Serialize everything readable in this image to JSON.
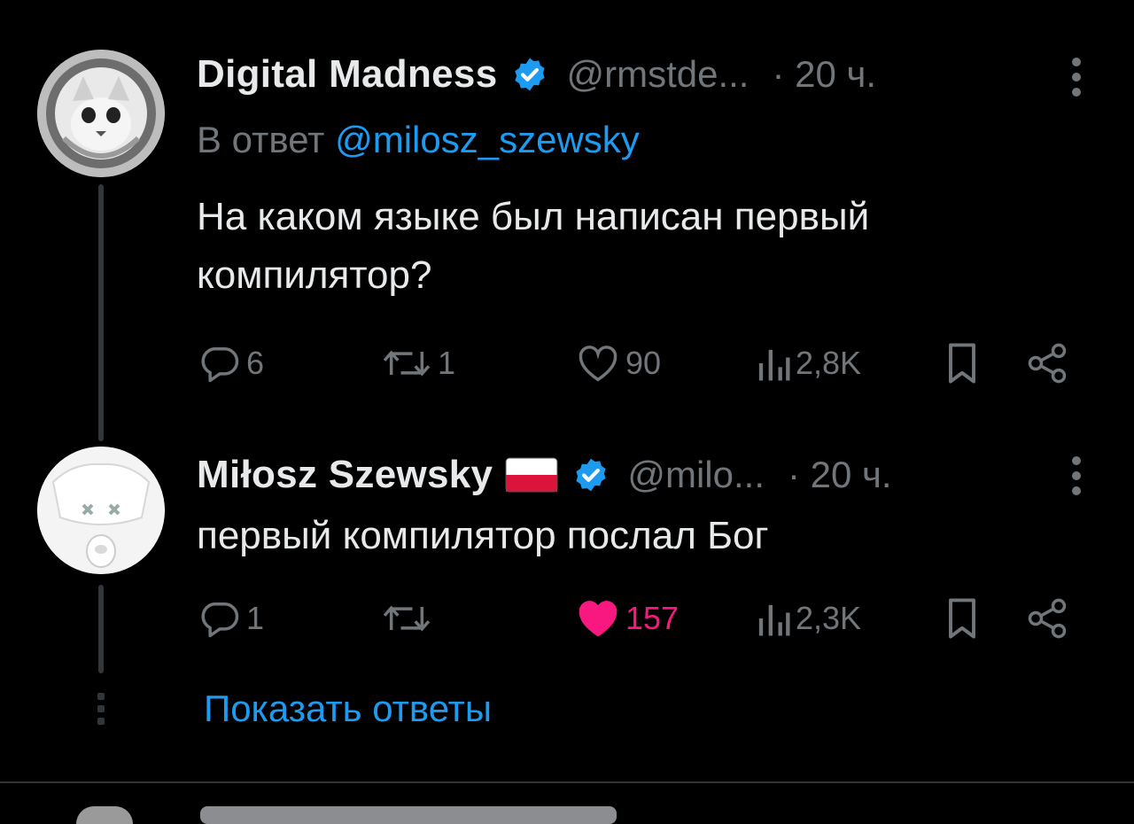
{
  "tweets": [
    {
      "author_name": "Digital Madness",
      "verified": true,
      "handle": "@rmstde...",
      "time": "· 20 ч.",
      "reply_prefix": "В ответ",
      "reply_mention": "@milosz_szewsky",
      "text": "На каком языке был написан первый компилятор?",
      "replies": "6",
      "retweets": "1",
      "likes": "90",
      "liked": false,
      "views": "2,8K",
      "avatar_icon": "cat-astronaut-avatar-icon"
    },
    {
      "author_name": "Miłosz Szewsky",
      "flag_icon": "poland-flag-icon",
      "verified": true,
      "handle": "@milo...",
      "time": "· 20 ч.",
      "text": "первый компилятор послал Бог",
      "replies": "1",
      "retweets": "",
      "likes": "157",
      "liked": true,
      "views": "2,3K",
      "avatar_icon": "dog-avatar-icon"
    }
  ],
  "show_replies": "Показать ответы",
  "colors": {
    "background": "#000000",
    "text": "#e7e9ea",
    "muted": "#71767b",
    "accent": "#1d9bf0",
    "like": "#f91880"
  }
}
